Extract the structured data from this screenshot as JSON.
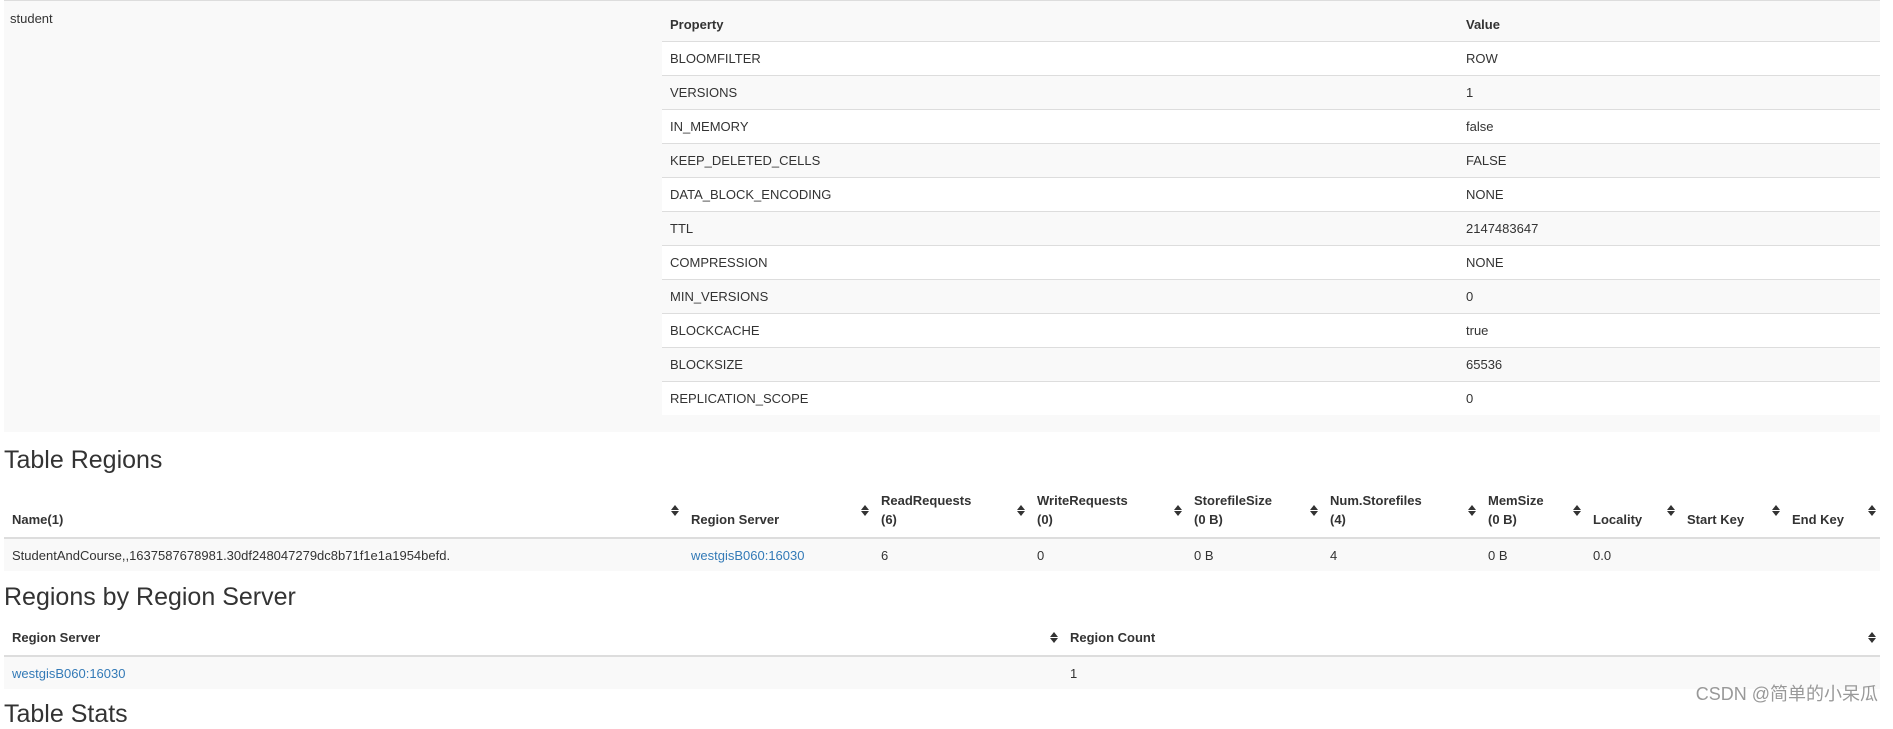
{
  "column_family": {
    "name": "student",
    "headers": {
      "property": "Property",
      "value": "Value"
    },
    "properties": [
      {
        "property": "BLOOMFILTER",
        "value": "ROW"
      },
      {
        "property": "VERSIONS",
        "value": "1"
      },
      {
        "property": "IN_MEMORY",
        "value": "false"
      },
      {
        "property": "KEEP_DELETED_CELLS",
        "value": "FALSE"
      },
      {
        "property": "DATA_BLOCK_ENCODING",
        "value": "NONE"
      },
      {
        "property": "TTL",
        "value": "2147483647"
      },
      {
        "property": "COMPRESSION",
        "value": "NONE"
      },
      {
        "property": "MIN_VERSIONS",
        "value": "0"
      },
      {
        "property": "BLOCKCACHE",
        "value": "true"
      },
      {
        "property": "BLOCKSIZE",
        "value": "65536"
      },
      {
        "property": "REPLICATION_SCOPE",
        "value": "0"
      }
    ]
  },
  "table_regions": {
    "title": "Table Regions",
    "columns": [
      {
        "line1": "",
        "line2": "Name(1)"
      },
      {
        "line1": "",
        "line2": "Region Server"
      },
      {
        "line1": "ReadRequests",
        "line2": "(6)"
      },
      {
        "line1": "WriteRequests",
        "line2": "(0)"
      },
      {
        "line1": "StorefileSize",
        "line2": "(0 B)"
      },
      {
        "line1": "Num.Storefiles",
        "line2": "(4)"
      },
      {
        "line1": "MemSize",
        "line2": "(0 B)"
      },
      {
        "line1": "",
        "line2": "Locality"
      },
      {
        "line1": "",
        "line2": "Start Key"
      },
      {
        "line1": "",
        "line2": "End Key"
      }
    ],
    "rows": [
      {
        "name": "StudentAndCourse,,1637587678981.30df248047279dc8b71f1e1a1954befd.",
        "region_server": "westgisB060:16030",
        "read_requests": "6",
        "write_requests": "0",
        "storefile_size": "0 B",
        "num_storefiles": "4",
        "mem_size": "0 B",
        "locality": "0.0",
        "start_key": "",
        "end_key": ""
      }
    ]
  },
  "regions_by_server": {
    "title": "Regions by Region Server",
    "columns": [
      "Region Server",
      "Region Count"
    ],
    "rows": [
      {
        "region_server": "westgisB060:16030",
        "region_count": "1"
      }
    ]
  },
  "next_section": {
    "title": "Table Stats"
  },
  "watermark": "CSDN @简单的小呆瓜",
  "colors": {
    "link": "#337ab7",
    "stripe": "#f9f9f9",
    "border": "#dddddd",
    "text": "#333333"
  }
}
